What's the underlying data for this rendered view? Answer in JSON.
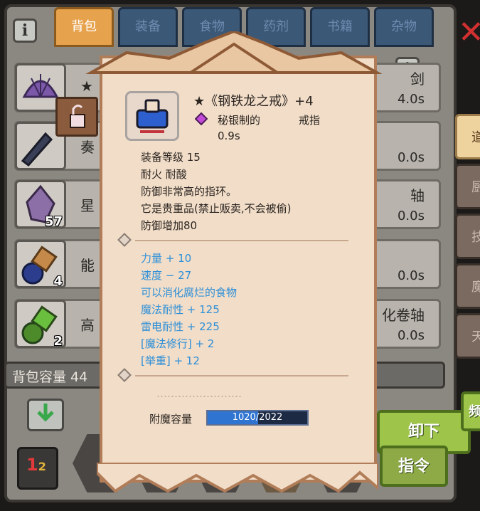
{
  "tabs": [
    "背包",
    "装备",
    "食物",
    "药剂",
    "书籍",
    "杂物"
  ],
  "active_tab": 0,
  "rows": [
    {
      "prefix": "★",
      "right_label": "剑",
      "time": "4.0s",
      "count": ""
    },
    {
      "prefix": "奏",
      "right_label": "",
      "time": "0.0s",
      "count": ""
    },
    {
      "prefix": "星",
      "right_label": "轴",
      "time": "0.0s",
      "count": "57"
    },
    {
      "prefix": "能",
      "right_label": "",
      "time": "0.0s",
      "count": "4"
    },
    {
      "prefix": "高",
      "right_label": "化卷轴",
      "time": "0.0s",
      "count": "2"
    }
  ],
  "capacity_label": "背包容量 44",
  "side_tabs": [
    "道",
    "厨",
    "技",
    "魔",
    "天"
  ],
  "buttons": {
    "unequip": "卸下",
    "command": "指令",
    "side_label": "频"
  },
  "tooltip": {
    "title": "★《钢铁龙之戒》+4",
    "material": "秘银制的",
    "type": "戒指",
    "time": "0.9s",
    "level": "装备等级 15",
    "traits": "耐火  耐酸",
    "desc1": "防御非常高的指环。",
    "desc2": "它是贵重品(禁止贩卖,不会被偷)",
    "defense": "防御增加80",
    "stats": [
      "力量 + 10",
      "速度 − 27",
      "可以消化腐烂的食物",
      "魔法耐性 + 125",
      "雷电耐性 + 225",
      "[魔法修行] + 2",
      "[举重] + 12"
    ],
    "faded_line": "……………………",
    "enchant_label": "附魔容量",
    "enchant_value": "1020/2022",
    "enchant_fraction": 0.504
  },
  "colors": {
    "card_bg": "#f1ddc8",
    "card_border": "#b17d58",
    "stat_blue": "#2d8fd8",
    "active_tab": "#e7a24d",
    "tab": "#3b5877",
    "button_green": "#9ec54a"
  }
}
